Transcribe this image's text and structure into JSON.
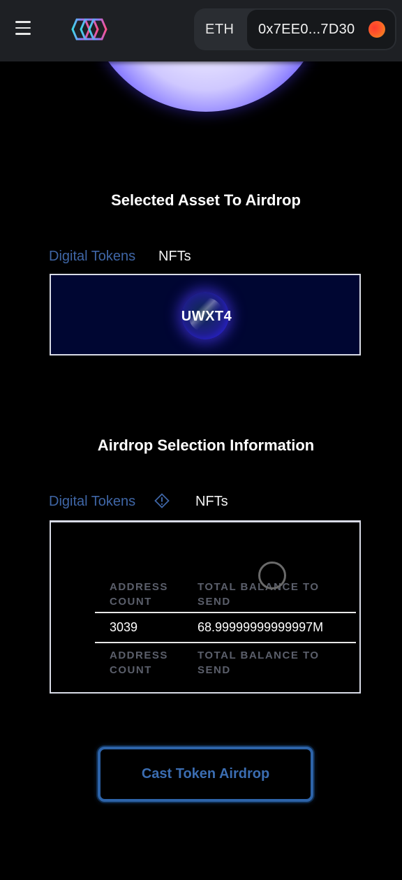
{
  "header": {
    "network_label": "ETH",
    "wallet_address": "0x7EE0...7D30",
    "menu_icon": "hamburger-menu-icon",
    "logo_icon": "app-logo-icon",
    "avatar_icon": "wallet-avatar-icon"
  },
  "asset_section": {
    "title": "Selected Asset To Airdrop",
    "tabs": [
      {
        "label": "Digital Tokens",
        "active": true
      },
      {
        "label": "NFTs",
        "active": false
      }
    ],
    "selected_token": "UWXT4"
  },
  "info_section": {
    "title": "Airdrop Selection Information",
    "tabs": [
      {
        "label": "Digital Tokens",
        "active": true
      },
      {
        "label": "NFTs",
        "active": false
      }
    ],
    "warning_icon": "warning-diamond-icon",
    "table": {
      "headers": [
        "ADDRESS COUNT",
        "TOTAL BALANCE TO SEND"
      ],
      "rows": [
        [
          "3039",
          "68.99999999999997M"
        ]
      ],
      "footers": [
        "ADDRESS COUNT",
        "TOTAL BALANCE TO SEND"
      ]
    },
    "loading_icon": "loading-spinner-icon"
  },
  "actions": {
    "cast_label": "Cast Token Airdrop"
  },
  "colors": {
    "accent_blue": "#3f66a6",
    "button_border": "#2d63a8",
    "background": "#000000",
    "topbar": "#1e2024"
  }
}
